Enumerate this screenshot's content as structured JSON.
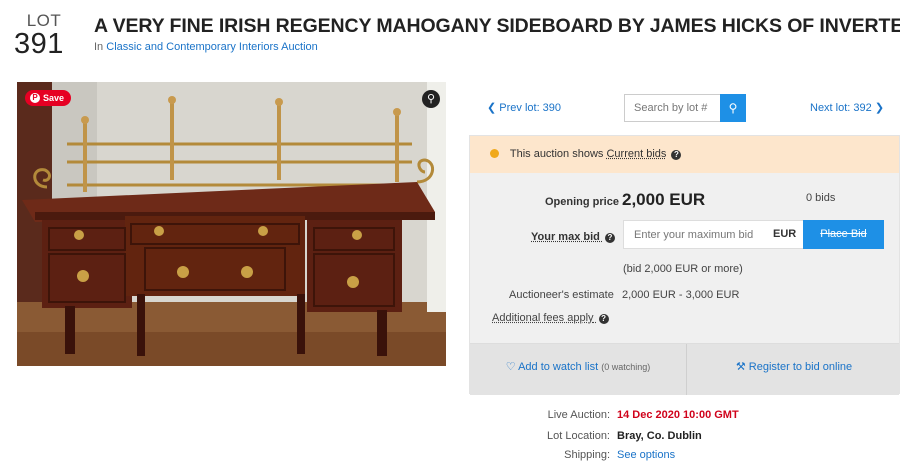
{
  "lot": {
    "label": "LOT",
    "number": "391"
  },
  "title": "A VERY FINE IRISH REGENCY MAHOGANY SIDEBOARD BY JAMES HICKS OF INVERTED",
  "subtitle": {
    "prefix": "In",
    "link": "Classic and Contemporary Interiors Auction"
  },
  "photo": {
    "save_label": "Save"
  },
  "nav": {
    "prev": "Prev lot: 390",
    "next": "Next lot: 392",
    "search_placeholder": "Search by lot #"
  },
  "notice": {
    "prefix": "This auction shows",
    "emphasis": "Current bids"
  },
  "bidding": {
    "opening_label": "Opening price",
    "opening_value": "2,000 EUR",
    "bids": "0 bids",
    "max_bid_label": "Your max bid",
    "max_bid_placeholder": "Enter your maximum bid",
    "currency": "EUR",
    "place_bid": "Place Bid",
    "hint": "(bid 2,000 EUR or more)",
    "estimate_label": "Auctioneer's estimate",
    "estimate_value": "2,000 EUR - 3,000 EUR",
    "fees_label": "Additional fees apply"
  },
  "actions": {
    "watch": "Add to watch list",
    "watch_count": "(0 watching)",
    "register": "Register to bid online"
  },
  "info": {
    "auction_label": "Live Auction:",
    "auction_value": "14 Dec 2020 10:00 GMT",
    "location_label": "Lot Location:",
    "location_value": "Bray, Co. Dublin",
    "shipping_label": "Shipping:",
    "shipping_value": "See options"
  },
  "colors": {
    "accent": "#1e90e6",
    "link": "#1a73c8",
    "alert": "#d0021b",
    "notice_bg": "#fde6cc"
  }
}
